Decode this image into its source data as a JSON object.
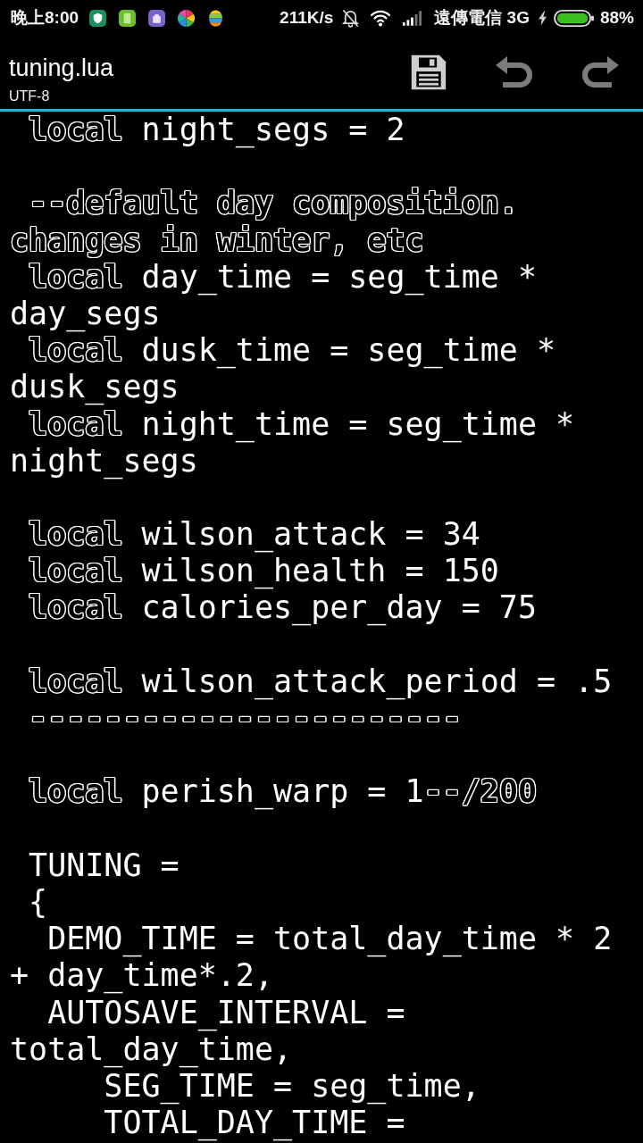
{
  "status_bar": {
    "time": "晚上8:00",
    "speed": "211K/s",
    "carrier": "遠傳電信 3G",
    "battery": "88%"
  },
  "app_bar": {
    "title": "tuning.lua",
    "subtitle": "UTF-8",
    "actions": [
      {
        "kind": "save",
        "disabled": false
      },
      {
        "kind": "undo",
        "disabled": true
      },
      {
        "kind": "redo",
        "disabled": true
      }
    ]
  },
  "editor": {
    "lines": [
      {
        "kind": "code",
        "spans": [
          {
            "kind": "keyword",
            "text": " local"
          },
          {
            "kind": "plain",
            "text": " night_segs = 2"
          }
        ]
      },
      {
        "kind": "blank"
      },
      {
        "kind": "code",
        "spans": [
          {
            "kind": "comment",
            "text": " --default day composition."
          }
        ]
      },
      {
        "kind": "code",
        "spans": [
          {
            "kind": "comment",
            "text": "changes in winter, etc"
          }
        ]
      },
      {
        "kind": "code",
        "spans": [
          {
            "kind": "keyword",
            "text": " local"
          },
          {
            "kind": "plain",
            "text": " day_time = seg_time *"
          }
        ]
      },
      {
        "kind": "code",
        "spans": [
          {
            "kind": "plain",
            "text": "day_segs"
          }
        ]
      },
      {
        "kind": "code",
        "spans": [
          {
            "kind": "keyword",
            "text": " local"
          },
          {
            "kind": "plain",
            "text": " dusk_time = seg_time *"
          }
        ]
      },
      {
        "kind": "code",
        "spans": [
          {
            "kind": "plain",
            "text": "dusk_segs"
          }
        ]
      },
      {
        "kind": "code",
        "spans": [
          {
            "kind": "keyword",
            "text": " local"
          },
          {
            "kind": "plain",
            "text": " night_time = seg_time *"
          }
        ]
      },
      {
        "kind": "code",
        "spans": [
          {
            "kind": "plain",
            "text": "night_segs"
          }
        ]
      },
      {
        "kind": "blank"
      },
      {
        "kind": "code",
        "spans": [
          {
            "kind": "keyword",
            "text": " local"
          },
          {
            "kind": "plain",
            "text": " wilson_attack = 34"
          }
        ]
      },
      {
        "kind": "code",
        "spans": [
          {
            "kind": "keyword",
            "text": " local"
          },
          {
            "kind": "plain",
            "text": " wilson_health = 150"
          }
        ]
      },
      {
        "kind": "code",
        "spans": [
          {
            "kind": "keyword",
            "text": " local"
          },
          {
            "kind": "plain",
            "text": " calories_per_day = 75"
          }
        ]
      },
      {
        "kind": "blank"
      },
      {
        "kind": "code",
        "spans": [
          {
            "kind": "keyword",
            "text": " local"
          },
          {
            "kind": "plain",
            "text": " wilson_attack_period = .5"
          }
        ]
      },
      {
        "kind": "code",
        "spans": [
          {
            "kind": "comment",
            "text": " -----------------------"
          }
        ]
      },
      {
        "kind": "blank"
      },
      {
        "kind": "code",
        "spans": [
          {
            "kind": "keyword",
            "text": " local"
          },
          {
            "kind": "plain",
            "text": " perish_warp = 1"
          },
          {
            "kind": "comment",
            "text": "--/200"
          }
        ]
      },
      {
        "kind": "blank"
      },
      {
        "kind": "code",
        "spans": [
          {
            "kind": "plain",
            "text": " TUNING ="
          }
        ]
      },
      {
        "kind": "code",
        "spans": [
          {
            "kind": "plain",
            "text": " {"
          }
        ]
      },
      {
        "kind": "code",
        "spans": [
          {
            "kind": "plain",
            "text": "  DEMO_TIME = total_day_time * 2"
          }
        ]
      },
      {
        "kind": "code",
        "spans": [
          {
            "kind": "plain",
            "text": "+ day_time*.2,"
          }
        ]
      },
      {
        "kind": "code",
        "spans": [
          {
            "kind": "plain",
            "text": "  AUTOSAVE_INTERVAL ="
          }
        ]
      },
      {
        "kind": "code",
        "spans": [
          {
            "kind": "plain",
            "text": "total_day_time,"
          }
        ]
      },
      {
        "kind": "code",
        "spans": [
          {
            "kind": "plain",
            "text": "     SEG_TIME = seg_time,"
          }
        ]
      },
      {
        "kind": "code",
        "spans": [
          {
            "kind": "plain",
            "text": "     TOTAL_DAY_TIME ="
          }
        ]
      }
    ]
  }
}
